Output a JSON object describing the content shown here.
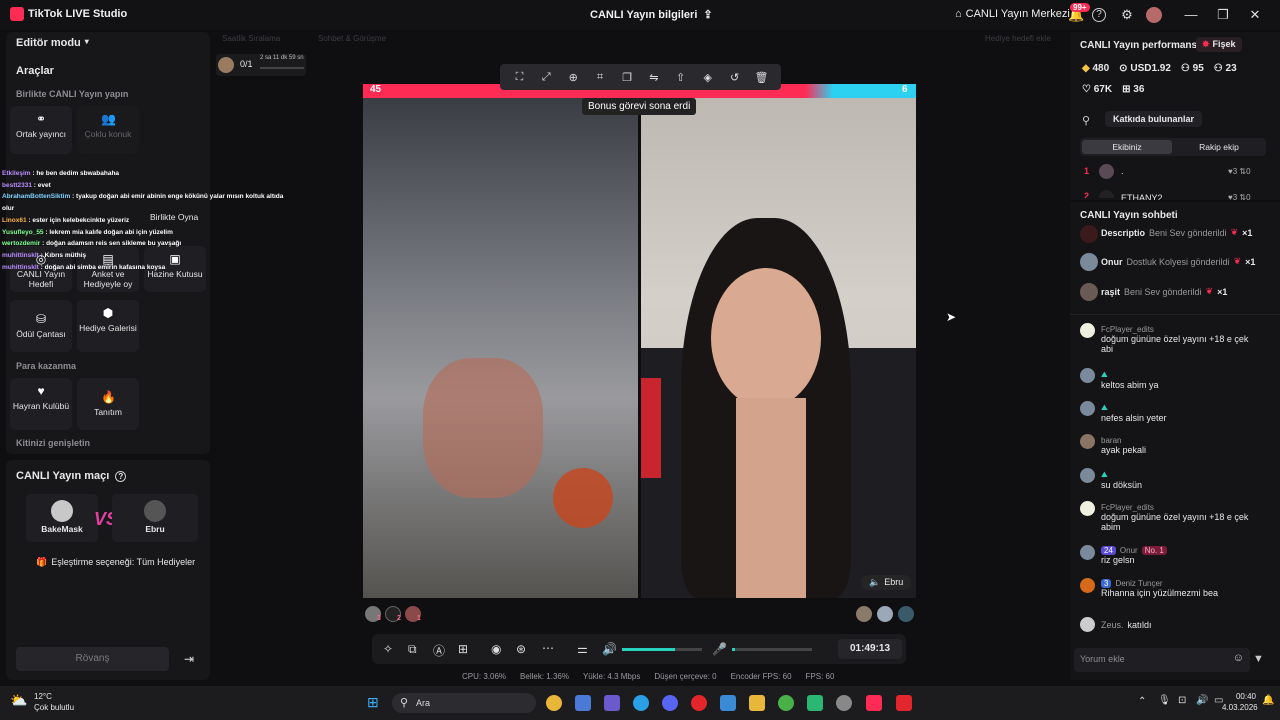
{
  "titlebar": {
    "app_name": "TikTok LIVE Studio",
    "center_title": "CANLI Yayın bilgileri",
    "center_link": "CANLI Yayın Merkezi",
    "notif_badge": "99+"
  },
  "left": {
    "editor_mode": "Editör modu",
    "tools_title": "Araçlar",
    "together_label": "Birlikte CANLI Yayın yapın",
    "cohost": "Ortak yayıncı",
    "multi_guest": "Çoklu konuk",
    "playtogether": "Birlikte Oyna",
    "live_goal": "CANLI Yayın Hedefi",
    "poll": "Anket ve Hediyeyle oy",
    "treasure": "Hazine Kutusu",
    "reward_bag": "Ödül Çantası",
    "gift_gallery": "Hediye Galerisi",
    "monetize_label": "Para kazanma",
    "fan_club": "Hayran Kulübü",
    "intro": "Tanıtım",
    "expand_kit": "Kitinizi genişletin"
  },
  "chat_overlay": [
    {
      "user": "Etkileşim",
      "msg": "he ben dedim sbwabahaha"
    },
    {
      "user": "bestt2331",
      "msg": "evet"
    },
    {
      "user": "AbrahamBottenSiktim",
      "msg": "tyakup doğan abi emir abinin enge kökünü yalar mısın koltuk altıda olur"
    },
    {
      "user": "Linox61",
      "msg": "ester için kelebekcinkte yüzeriz"
    },
    {
      "user": "Yusufleyo_55",
      "msg": "lekrem mia kalıfe doğan abi için yüzelim"
    },
    {
      "user": "wertozdemir",
      "msg": "doğan adamsın reis sen sikleme bu yavşağı"
    },
    {
      "user": "muhittinsklt",
      "msg": "Kıbrıs müthiş"
    },
    {
      "user": "muhittinsklt",
      "msg": "doğan abi simba emirin kafasına koysa"
    }
  ],
  "match": {
    "title": "CANLI Yayın maçı",
    "player1": "BakeMask",
    "player2": "Ebru",
    "vs": "VS",
    "pairing": "Eşleştirme seçeneği: Tüm Hediyeler",
    "rematch": "Rövanş"
  },
  "center": {
    "tab1": "Saatlik Sıralama",
    "tab2": "Sohbet & Görüşme",
    "goal": "Hediye hedefi ekle",
    "goal_progress": "0/1",
    "goal_time": "2 sa 11 dk 59 sn",
    "score_left": "45",
    "score_right": "6",
    "toast": "Bonus görevi sona erdi",
    "right_label": "Ebru",
    "timer": "01:49:13",
    "left_counts": [
      "3",
      "2",
      "1"
    ]
  },
  "stats": {
    "cpu": "CPU: 3.06%",
    "memory": "Bellek: 1.36%",
    "upload": "Yükle: 4.3 Mbps",
    "dropped": "Düşen çerçeve: 0",
    "encoder_fps": "Encoder FPS: 60",
    "fps": "FPS: 60"
  },
  "right": {
    "perf_title": "CANLI Yayın performansı",
    "perf_tag": "Fişek",
    "coins": "480",
    "usd": "USD1.92",
    "viewers": "95",
    "new_followers": "23",
    "likes": "67K",
    "gifts": "36",
    "contributors": "Katkıda bulunanlar",
    "team_tab": "Ekibiniz",
    "rival_tab": "Rakip ekip",
    "rank1_name": ".",
    "rank1_score": "3",
    "rank1_zero": "0",
    "rank2_name": "ETHANY2",
    "rank2_score": "3",
    "rank2_zero": "0",
    "chat_title": "CANLI Yayın sohbeti",
    "gifts_list": [
      {
        "user": "Descriptio",
        "msg": "Beni Sev gönderildi",
        "count": "×1"
      },
      {
        "user": "Onur",
        "msg": "Dostluk Kolyesi gönderildi",
        "count": "×1"
      },
      {
        "user": "raşit",
        "msg": "Beni Sev gönderildi",
        "count": "×1"
      }
    ],
    "messages": [
      {
        "user": "FcPlayer_edits",
        "msg": "doğum gününe özel yayını +18 e çek abi"
      },
      {
        "user": "",
        "msg": "keltos abim ya"
      },
      {
        "user": "",
        "msg": "nefes alsin yeter"
      },
      {
        "user": "baran",
        "msg": "ayak pekali"
      },
      {
        "user": "",
        "msg": "su döksün"
      },
      {
        "user": "FcPlayer_edits",
        "msg": "doğum gününe özel yayını +18 e çek abim"
      },
      {
        "user": "Onur",
        "msg": "riz gelsn",
        "level": "24",
        "tag": "No. 1"
      },
      {
        "user": "Deniz Tunçer",
        "msg": "Rihanna için yüzülmezmi bea",
        "level": "3"
      }
    ],
    "joined_user": "Zeus.",
    "joined_msg": "katıldı",
    "comment_placeholder": "Yorum ekle"
  },
  "taskbar": {
    "temp": "12°C",
    "weather": "Çok bulutlu",
    "search": "Ara",
    "time": "00:40",
    "date": "4.03.2026"
  }
}
